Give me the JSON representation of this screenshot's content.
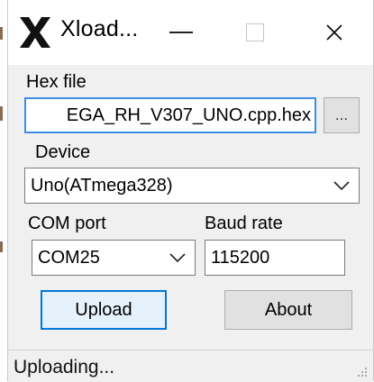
{
  "window": {
    "title": "Xload...",
    "icon": "x-logo-icon"
  },
  "title_controls": {
    "minimize_icon": "minimize-icon",
    "maximize_icon": "maximize-icon",
    "close_glyph": "✕"
  },
  "hex": {
    "label": "Hex file",
    "value": "EGA_RH_V307_UNO.cpp.hex",
    "browse_label": "..."
  },
  "device": {
    "label": "Device",
    "selected": "Uno(ATmega328)"
  },
  "com": {
    "label": "COM port",
    "selected": "COM25"
  },
  "baud": {
    "label": "Baud rate",
    "value": "115200"
  },
  "buttons": {
    "upload": "Upload",
    "about": "About"
  },
  "status": {
    "text": "Uploading..."
  },
  "colors": {
    "focus_border": "#3a8ee6",
    "primary_button_bg": "#e5f1fb",
    "primary_button_border": "#0078d7",
    "window_bg": "#f0f0f0"
  }
}
